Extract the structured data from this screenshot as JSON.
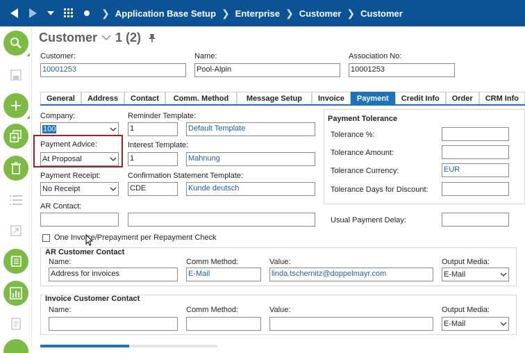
{
  "breadcrumb": [
    "Application Base Setup",
    "Enterprise",
    "Customer",
    "Customer"
  ],
  "page": {
    "title": "Customer",
    "record_position": "1 (2)"
  },
  "header_fields": {
    "customer_label": "Customer:",
    "customer_value": "10001253",
    "name_label": "Name:",
    "name_value": "Pool-Alpin",
    "association_label": "Association No:",
    "association_value": "10001253"
  },
  "tabs": [
    "General",
    "Address",
    "Contact",
    "Comm. Method",
    "Message Setup",
    "Invoice",
    "Payment",
    "Credit Info",
    "Order",
    "CRM Info"
  ],
  "active_tab": "Payment",
  "payment": {
    "company_label": "Company:",
    "company_value": "100",
    "reminder_template_label": "Reminder Template:",
    "reminder_template_id": "1",
    "reminder_template_desc": "Default Template",
    "payment_advice_label": "Payment Advice:",
    "payment_advice_value": "At Proposal",
    "interest_template_label": "Interest Template:",
    "interest_template_id": "1",
    "interest_template_desc": "Mahnung",
    "payment_receipt_label": "Payment Receipt:",
    "payment_receipt_value": "No Receipt",
    "confirmation_label": "Confirmation Statement Template:",
    "confirmation_id": "CDE",
    "confirmation_desc": "Kunde deutsch",
    "ar_contact_label": "AR Contact:",
    "ar_contact_value": "",
    "ar_contact_desc": "",
    "one_invoice_label": "One Invoice/Prepayment per Repayment Check",
    "one_invoice_checked": false
  },
  "tolerance": {
    "title": "Payment Tolerance",
    "tolerance_pct_label": "Tolerance %:",
    "tolerance_pct_value": "",
    "tolerance_amount_label": "Tolerance Amount:",
    "tolerance_amount_value": "",
    "tolerance_currency_label": "Tolerance Currency:",
    "tolerance_currency_value": "EUR",
    "tolerance_days_label": "Tolerance Days for Discount:",
    "tolerance_days_value": "",
    "usual_delay_label": "Usual Payment Delay:",
    "usual_delay_value": ""
  },
  "ar_customer_contact": {
    "title": "AR Customer Contact",
    "name_label": "Name:",
    "name_value": "Address for invoices",
    "comm_method_label": "Comm Method:",
    "comm_method_value": "E-Mail",
    "value_label": "Value:",
    "value_value": "linda.tschernitz@doppelmayr.com",
    "output_media_label": "Output Media:",
    "output_media_value": "E-Mail"
  },
  "invoice_customer_contact": {
    "title": "Invoice Customer Contact",
    "name_label": "Name:",
    "name_value": "",
    "comm_method_label": "Comm Method:",
    "comm_method_value": "",
    "value_label": "Value:",
    "value_value": "",
    "output_media_label": "Output Media:",
    "output_media_value": "E-Mail"
  },
  "colors": {
    "topbar": "#0b5394",
    "accent": "#1e73be",
    "sidebar_green": "#7dbb44",
    "highlight": "#b3181e",
    "link": "#1f5fa8"
  },
  "sidebar_icons": [
    "search-icon",
    "save-icon",
    "add-icon",
    "duplicate-icon",
    "delete-icon",
    "list-icon",
    "external-link-icon",
    "notes-icon",
    "chart-icon",
    "document-icon",
    "more-icon"
  ]
}
